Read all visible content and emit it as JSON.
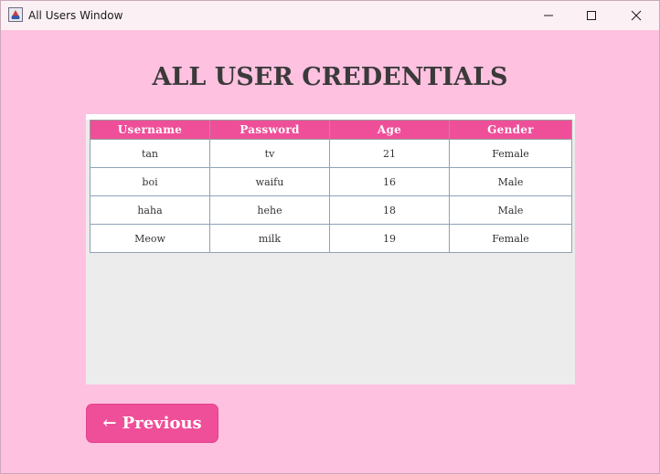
{
  "window": {
    "title": "All Users Window",
    "controls": {
      "minimize_icon": "minimize-icon",
      "maximize_icon": "maximize-icon",
      "close_icon": "close-icon"
    }
  },
  "main": {
    "heading": "ALL USER CREDENTIALS",
    "table": {
      "headers": [
        "Username",
        "Password",
        "Age",
        "Gender"
      ],
      "rows": [
        [
          "tan",
          "tv",
          "21",
          "Female"
        ],
        [
          "boi",
          "waifu",
          "16",
          "Male"
        ],
        [
          "haha",
          "hehe",
          "18",
          "Male"
        ],
        [
          "Meow",
          "milk",
          "19",
          "Female"
        ]
      ]
    },
    "previous_button": "← Previous"
  },
  "colors": {
    "background": "#ffc1e0",
    "accent": "#ef4f99",
    "heading_text": "#3a3a3a",
    "table_panel": "#ececec"
  }
}
